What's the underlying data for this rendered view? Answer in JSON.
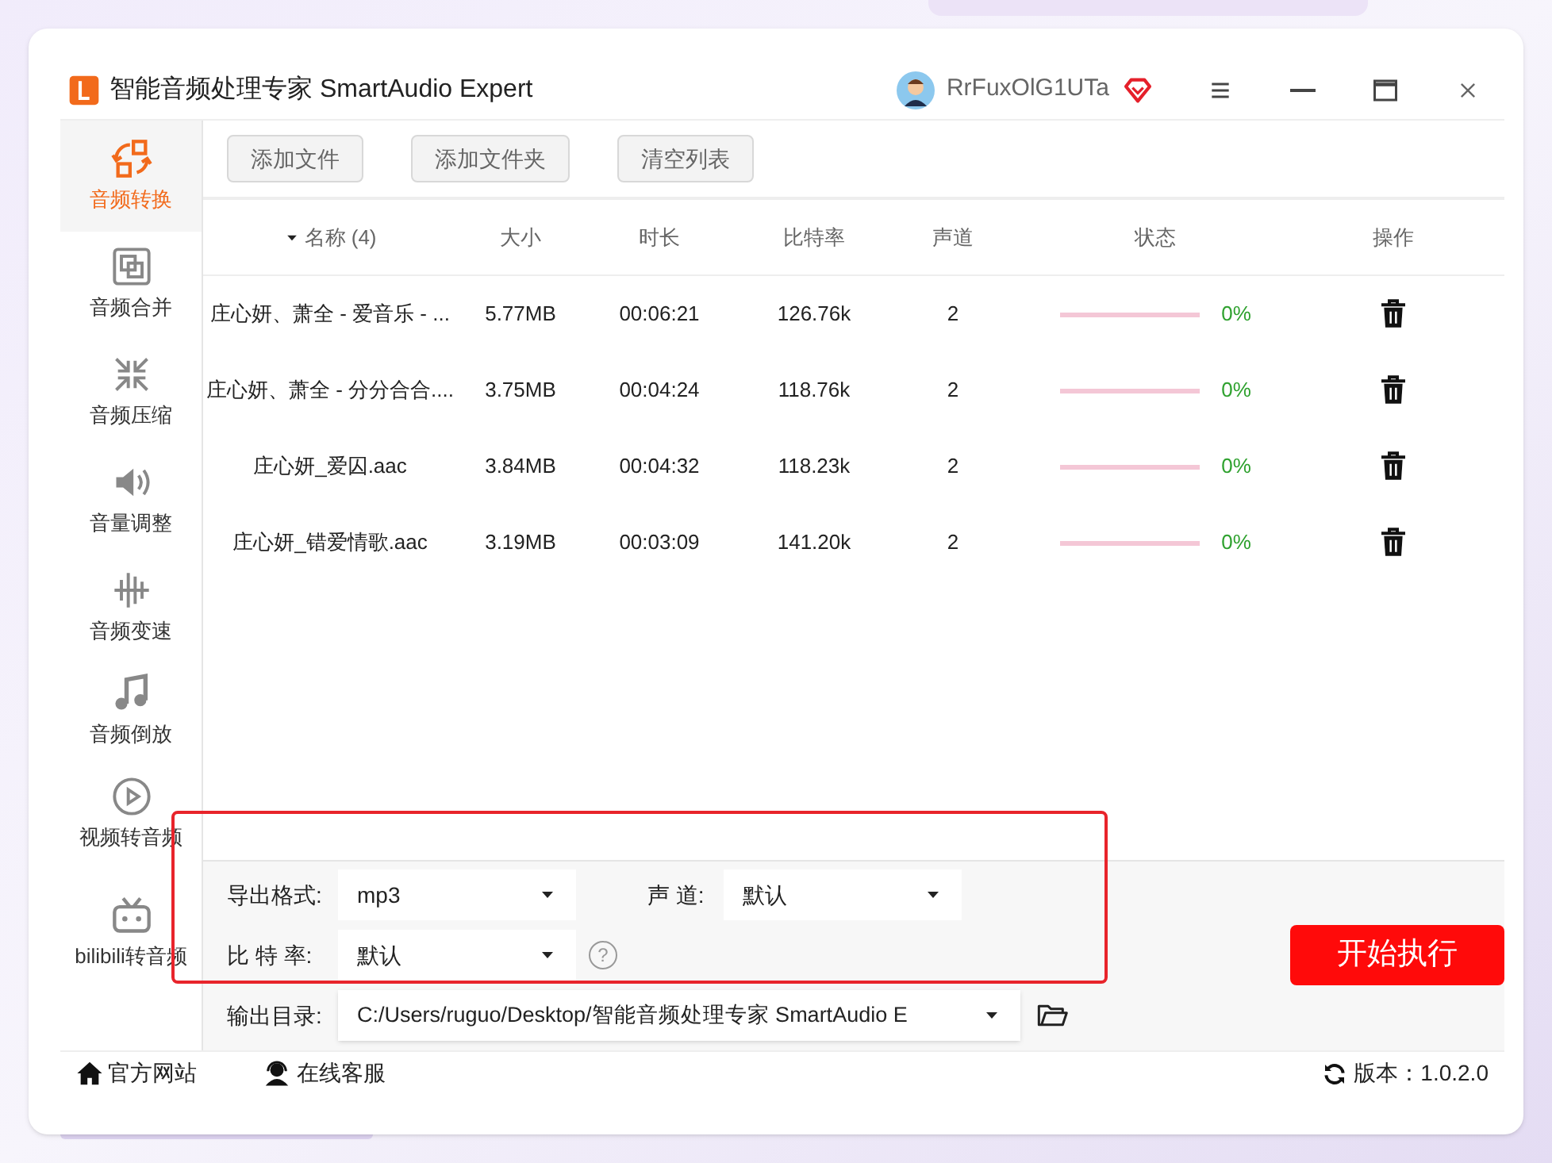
{
  "window": {
    "title": "智能音频处理专家 SmartAudio Expert",
    "username": "RrFuxOlG1UTa"
  },
  "sidebar": {
    "items": [
      {
        "kind": "convert",
        "label": "音频转换",
        "selected": true
      },
      {
        "kind": "merge",
        "label": "音频合并",
        "selected": false
      },
      {
        "kind": "compress",
        "label": "音频压缩",
        "selected": false
      },
      {
        "kind": "volume",
        "label": "音量调整",
        "selected": false
      },
      {
        "kind": "speed",
        "label": "音频变速",
        "selected": false
      },
      {
        "kind": "reverse",
        "label": "音频倒放",
        "selected": false
      },
      {
        "kind": "video",
        "label": "视频转音频",
        "selected": false
      },
      {
        "kind": "bilibili",
        "label": "bilibili转音频",
        "selected": false
      }
    ]
  },
  "toolbar": [
    "添加文件",
    "添加文件夹",
    "清空列表"
  ],
  "table": {
    "columns": [
      "名称 (4)",
      "大小",
      "时长",
      "比特率",
      "声道",
      "状态",
      "操作"
    ],
    "rows": [
      {
        "name": "庄心妍、萧全 - 爱音乐 - ...",
        "size": "5.77MB",
        "duration": "00:06:21",
        "bitrate": "126.76k",
        "channels": "2",
        "level": 0,
        "progress": "0%"
      },
      {
        "name": "庄心妍、萧全 - 分分合合....",
        "size": "3.75MB",
        "duration": "00:04:24",
        "bitrate": "118.76k",
        "channels": "2",
        "level": 0,
        "progress": "0%"
      },
      {
        "name": "庄心妍_爱囚.aac",
        "size": "3.84MB",
        "duration": "00:04:32",
        "bitrate": "118.23k",
        "channels": "2",
        "level": 0,
        "progress": "0%"
      },
      {
        "name": "庄心妍_错爱情歌.aac",
        "size": "3.19MB",
        "duration": "00:03:09",
        "bitrate": "141.20k",
        "channels": "2",
        "level": 0,
        "progress": "0%"
      }
    ]
  },
  "settings": {
    "format_label": "导出格式:",
    "format": "mp3",
    "channel_label": "声 道:",
    "channel": "默认",
    "bitrate_label": "比 特 率:",
    "bitrate": "默认",
    "help": "?",
    "output_label": "输出目录:",
    "output": "C:/Users/ruguo/Desktop/智能音频处理专家 SmartAudio E",
    "start_button": "开始执行"
  },
  "status_bar": {
    "website": "官方网站",
    "support": "在线客服",
    "version": "版本：1.0.2.0"
  }
}
